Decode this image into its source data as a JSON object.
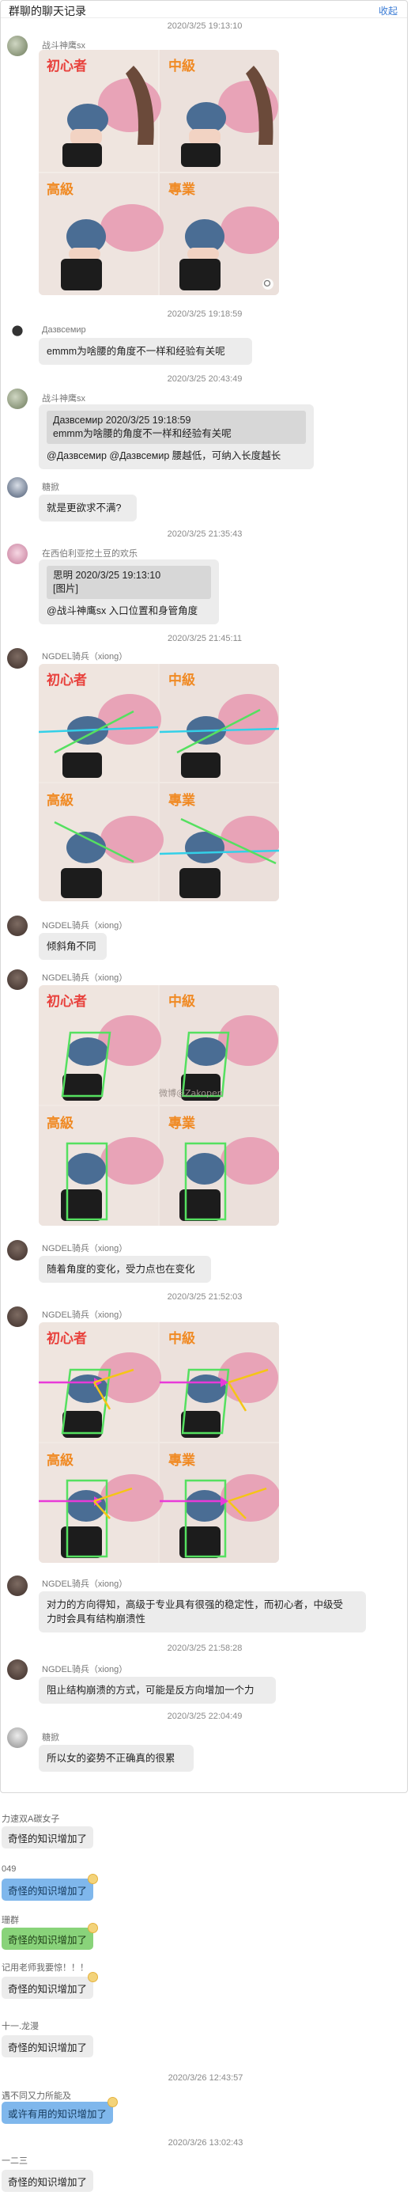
{
  "header": {
    "title": "群聊的聊天记录",
    "fold_label": "收起"
  },
  "timestamps": {
    "t1": "2020/3/25 19:13:10",
    "t2": "2020/3/25 19:18:59",
    "t3": "2020/3/25 20:43:49",
    "t4": "2020/3/25 21:35:43",
    "t5": "2020/3/25 21:45:11",
    "t6": "2020/3/25 21:52:03",
    "t7": "2020/3/25 21:58:28",
    "t8": "2020/3/25 22:04:49",
    "t9": "2020/3/26 12:43:57",
    "t10": "2020/3/26 13:02:43"
  },
  "messages": {
    "m1": {
      "sender": "战斗神鹰sx"
    },
    "m2": {
      "sender": "Дазвсемир",
      "text": "emmm为啥腰的角度不一样和经验有关呢"
    },
    "m3": {
      "sender": "战斗神鹰sx",
      "quote_line1": "Дазвсемир  2020/3/25 19:18:59",
      "quote_line2": "emmm为啥腰的角度不一样和经验有关呢",
      "text": "@Дазвсемир @Дазвсемир 腰越低，可纳入长度越长"
    },
    "m4": {
      "sender": "糖掀",
      "text": "就是更欲求不满?"
    },
    "m5": {
      "sender": "在西伯利亚挖土豆的欢乐",
      "quote_line1": "思明  2020/3/25 19:13:10",
      "quote_line2": "[图片]",
      "text": "@战斗神鹰sx 入口位置和身管角度"
    },
    "m6": {
      "sender": "NGDEL骑兵（xiong）"
    },
    "m7": {
      "sender": "NGDEL骑兵（xiong）",
      "text": "倾斜角不同"
    },
    "m8": {
      "sender": "NGDEL骑兵（xiong）"
    },
    "m9": {
      "sender": "NGDEL骑兵（xiong）",
      "text": "随着角度的变化，受力点也在变化"
    },
    "m10": {
      "sender": "NGDEL骑兵（xiong）"
    },
    "m11": {
      "sender": "NGDEL骑兵（xiong）",
      "text_line1": "对力的方向得知，高级于专业具有很强的稳定性，而初心者，中级受",
      "text_line2": "力时会具有结构崩溃性"
    },
    "m12": {
      "sender": "NGDEL骑兵（xiong）",
      "text": "阻止结构崩溃的方式，可能是反方向增加一个力"
    },
    "m13": {
      "sender": "糖掀",
      "text": "所以女的姿势不正确真的很累"
    }
  },
  "image_labels": {
    "beginner": "初心者",
    "intermediate": "中級",
    "advanced": "高級",
    "expert": "專業",
    "watermark": "微博@Zakopen"
  },
  "lower": {
    "n1": "力速双A碳女子",
    "b1": "奇怪的知识增加了",
    "n2": "049",
    "b2": "奇怪的知识增加了",
    "n3": "珊群",
    "b3": "奇怪的知识增加了",
    "n4": "记用老师我要惊！！！",
    "b4": "奇怪的知识增加了",
    "n5": "十一.龙漫",
    "b5": "奇怪的知识增加了",
    "n6": "遇不同又力所能及",
    "b6": "或许有用的知识增加了",
    "n7": "一二三",
    "b7": "奇怪的知识增加了"
  },
  "colors": {
    "label_red": "#e8413c",
    "label_orange": "#f08a24",
    "cyan_line": "#33d0e8",
    "green_line": "#55e060",
    "magenta_line": "#e83ad8",
    "yellow_line": "#f5c516",
    "bubble_grey": "#ececec",
    "bubble_blue": "#7fb7ec",
    "bubble_green": "#89d37a",
    "link_blue": "#3a7bd5"
  }
}
